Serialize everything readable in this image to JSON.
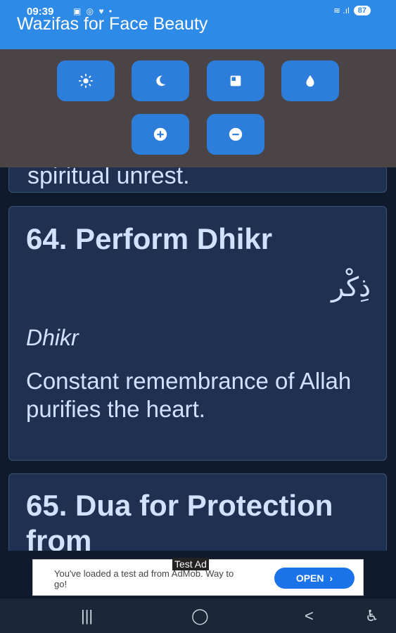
{
  "status_bar": {
    "time": "09:39",
    "left_icons": "▣ ◎ ♥ •",
    "right_icons": "≋ .ıl",
    "battery": "87"
  },
  "app": {
    "title": "Wazifas for Face Beauty"
  },
  "toolbar": {
    "buttons": [
      {
        "icon": "brightness-icon"
      },
      {
        "icon": "dark-mode-icon"
      },
      {
        "icon": "theme-icon"
      },
      {
        "icon": "color-icon"
      },
      {
        "icon": "zoom-in-icon"
      },
      {
        "icon": "zoom-out-icon"
      }
    ]
  },
  "cards": [
    {
      "partial_text": "spiritual unrest."
    },
    {
      "heading": "64. Perform Dhikr",
      "arabic": "ذِكْر",
      "transliteration": "Dhikr",
      "description": "Constant remembrance of Allah purifies the heart."
    },
    {
      "heading": "65. Dua for Protection from"
    }
  ],
  "ad": {
    "badge": "Test Ad",
    "text": "You've loaded a test ad from AdMob. Way to go!",
    "cta": "OPEN"
  },
  "nav": {
    "recents": "|||",
    "home": "◯",
    "back": "<",
    "accessibility": "♿"
  }
}
